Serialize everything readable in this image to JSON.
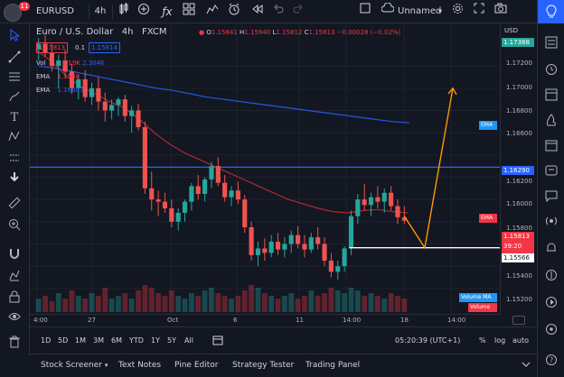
{
  "topbar": {
    "notification_count": "11",
    "symbol": "EURUSD",
    "interval": "4h",
    "fx_symbol": "ƒx",
    "layout_name": "Unnamed"
  },
  "legend": {
    "title": "Euro / U.S. Dollar",
    "interval": "4h",
    "exchange": "FXCM",
    "open_label": "O",
    "open": "1.15841",
    "high_label": "H",
    "high": "1.15940",
    "low_label": "L",
    "low": "1.15812",
    "close_label": "C",
    "close": "1.15813",
    "change": "−0.00028 (−0.02%)",
    "bid": "1.15813",
    "spread": "0.1",
    "ask": "1.15814",
    "vol_label": "Vol",
    "vol_value": "2.19K",
    "vol_ma": "2.304K",
    "ema1_label": "EMA",
    "ema1_value": "1.1588",
    "ema2_label": "EMA",
    "ema2_value": "1.16683"
  },
  "price_axis": {
    "currency": "USD",
    "labels": [
      "1.17200",
      "1.17000",
      "1.16800",
      "1.16600",
      "1.16200",
      "1.16000",
      "1.15800",
      "1.15400",
      "1.15200"
    ],
    "tag_top": "1.17388",
    "tag_ema_blue": "EMA",
    "tag_hline": "1.16290",
    "tag_ema_red": "EMA",
    "tag_price": "1.15813",
    "tag_countdown": "39:20",
    "tag_white": "1.15566",
    "tag_volume_ma": "Volume MA",
    "tag_volume": "Volume"
  },
  "time_axis": {
    "labels": [
      "4:00",
      "27",
      "Oct",
      "6",
      "11",
      "14:00",
      "18",
      "14:00"
    ]
  },
  "bottombar": {
    "ranges": [
      "1D",
      "5D",
      "1M",
      "3M",
      "6M",
      "YTD",
      "1Y",
      "5Y",
      "All"
    ],
    "clock": "05:20:39 (UTC+1)",
    "percent": "%",
    "log": "log",
    "auto": "auto"
  },
  "tabs": [
    "Stock Screener",
    "Text Notes",
    "Pine Editor",
    "Strategy Tester",
    "Trading Panel"
  ],
  "chart_data": {
    "type": "candlestick",
    "ylim": [
      1.1515,
      1.1755
    ],
    "candles": [
      [
        1.1735,
        1.1745,
        1.1725,
        1.174
      ],
      [
        1.174,
        1.1748,
        1.1728,
        1.1732
      ],
      [
        1.1732,
        1.174,
        1.1715,
        1.172
      ],
      [
        1.172,
        1.173,
        1.17,
        1.1725
      ],
      [
        1.1725,
        1.1735,
        1.171,
        1.1715
      ],
      [
        1.1715,
        1.1722,
        1.1695,
        1.17
      ],
      [
        1.17,
        1.1712,
        1.169,
        1.1708
      ],
      [
        1.1708,
        1.1716,
        1.1688,
        1.1692
      ],
      [
        1.1692,
        1.1705,
        1.1685,
        1.17
      ],
      [
        1.17,
        1.171,
        1.168,
        1.1688
      ],
      [
        1.1688,
        1.1696,
        1.167,
        1.168
      ],
      [
        1.168,
        1.169,
        1.1672,
        1.1685
      ],
      [
        1.1685,
        1.1692,
        1.1675,
        1.169
      ],
      [
        1.169,
        1.1694,
        1.167,
        1.1675
      ],
      [
        1.1675,
        1.1684,
        1.166,
        1.168
      ],
      [
        1.168,
        1.1686,
        1.1662,
        1.1665
      ],
      [
        1.1665,
        1.167,
        1.1605,
        1.161
      ],
      [
        1.161,
        1.1625,
        1.159,
        1.16
      ],
      [
        1.16,
        1.1608,
        1.1585,
        1.1598
      ],
      [
        1.1598,
        1.1606,
        1.1588,
        1.1592
      ],
      [
        1.1592,
        1.16,
        1.1575,
        1.158
      ],
      [
        1.158,
        1.1592,
        1.1572,
        1.1588
      ],
      [
        1.1588,
        1.16,
        1.158,
        1.1598
      ],
      [
        1.1598,
        1.1615,
        1.159,
        1.1612
      ],
      [
        1.1612,
        1.1622,
        1.16,
        1.1605
      ],
      [
        1.1605,
        1.162,
        1.1598,
        1.1618
      ],
      [
        1.1618,
        1.1634,
        1.161,
        1.163
      ],
      [
        1.163,
        1.1638,
        1.1612,
        1.1615
      ],
      [
        1.1615,
        1.1622,
        1.1598,
        1.1602
      ],
      [
        1.1602,
        1.1612,
        1.1594,
        1.1608
      ],
      [
        1.1608,
        1.1616,
        1.1596,
        1.16
      ],
      [
        1.16,
        1.1604,
        1.157,
        1.1575
      ],
      [
        1.1575,
        1.158,
        1.1545,
        1.155
      ],
      [
        1.155,
        1.1562,
        1.154,
        1.1556
      ],
      [
        1.1556,
        1.1565,
        1.1545,
        1.1552
      ],
      [
        1.1552,
        1.1568,
        1.1548,
        1.1562
      ],
      [
        1.1562,
        1.157,
        1.155,
        1.1555
      ],
      [
        1.1555,
        1.1566,
        1.1548,
        1.156
      ],
      [
        1.156,
        1.1572,
        1.1552,
        1.1568
      ],
      [
        1.1568,
        1.1576,
        1.1556,
        1.156
      ],
      [
        1.156,
        1.1568,
        1.1548,
        1.1555
      ],
      [
        1.1555,
        1.157,
        1.1552,
        1.1566
      ],
      [
        1.1566,
        1.1575,
        1.1555,
        1.156
      ],
      [
        1.156,
        1.1566,
        1.154,
        1.1545
      ],
      [
        1.1545,
        1.1552,
        1.153,
        1.1535
      ],
      [
        1.1535,
        1.1545,
        1.1528,
        1.154
      ],
      [
        1.154,
        1.1558,
        1.1535,
        1.1556
      ],
      [
        1.1556,
        1.159,
        1.155,
        1.1585
      ],
      [
        1.1585,
        1.1605,
        1.1578,
        1.16
      ],
      [
        1.16,
        1.1614,
        1.159,
        1.1595
      ],
      [
        1.1595,
        1.1606,
        1.1585,
        1.1602
      ],
      [
        1.1602,
        1.1612,
        1.1592,
        1.1598
      ],
      [
        1.1598,
        1.161,
        1.1588,
        1.1606
      ],
      [
        1.1606,
        1.1612,
        1.159,
        1.1594
      ],
      [
        1.1594,
        1.16,
        1.1578,
        1.1584
      ],
      [
        1.1584,
        1.1594,
        1.1578,
        1.1581
      ]
    ],
    "ema_slow": [
      1.172,
      1.1718,
      1.1715,
      1.1712,
      1.1709,
      1.1706,
      1.1703,
      1.17,
      1.1698,
      1.1695,
      1.1692,
      1.169,
      1.1688,
      1.1686,
      1.1684,
      1.1682,
      1.168,
      1.1678,
      1.1676,
      1.1674,
      1.1672,
      1.167,
      1.1669
    ],
    "ema_fast": [
      1.1735,
      1.1725,
      1.1712,
      1.1702,
      1.1695,
      1.1688,
      1.1682,
      1.1672,
      1.166,
      1.165,
      1.1642,
      1.1636,
      1.163,
      1.1624,
      1.1618,
      1.1612,
      1.1606,
      1.16,
      1.1596,
      1.1592,
      1.1589,
      1.1588,
      1.159,
      1.1591,
      1.1589,
      1.1588
    ],
    "horizontal_line": 1.1629,
    "white_line": 1.15566,
    "projection": [
      [
        1.1585,
        1.15566
      ],
      [
        1.15566,
        1.17
      ]
    ],
    "volume": [
      0.5,
      0.6,
      0.4,
      0.7,
      0.5,
      0.8,
      0.6,
      0.5,
      0.7,
      0.6,
      0.9,
      0.5,
      0.6,
      0.7,
      0.5,
      0.8,
      1.0,
      0.9,
      0.7,
      0.6,
      0.8,
      0.6,
      0.5,
      0.7,
      0.6,
      0.8,
      0.9,
      0.7,
      0.6,
      0.5,
      0.6,
      0.8,
      1.0,
      0.9,
      0.7,
      0.6,
      0.5,
      0.6,
      0.7,
      0.5,
      0.6,
      0.8,
      0.6,
      0.7,
      0.9,
      0.8,
      0.7,
      0.9,
      0.8,
      0.6,
      0.7,
      0.6,
      0.5,
      0.7,
      0.6,
      0.5
    ]
  }
}
